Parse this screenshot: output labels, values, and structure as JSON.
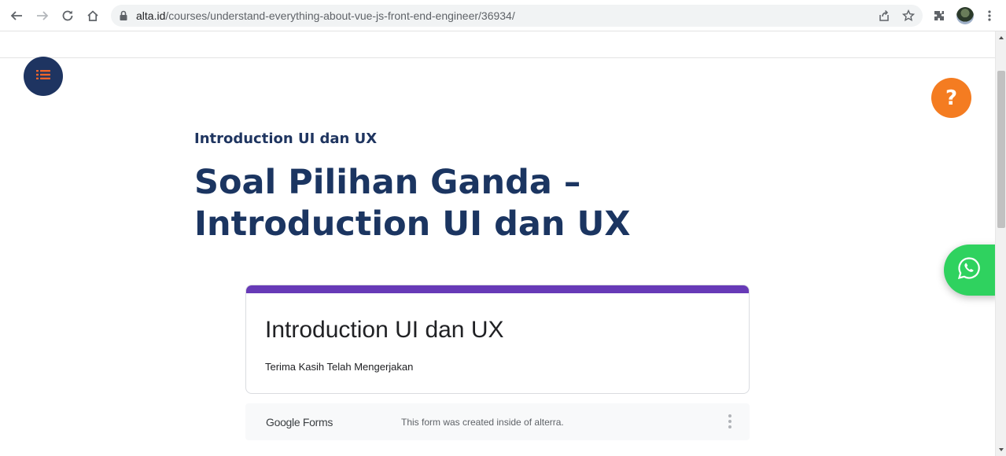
{
  "browser": {
    "url_host": "alta.id",
    "url_path": "/courses/understand-everything-about-vue-js-front-end-engineer/36934/"
  },
  "page": {
    "breadcrumb": "Introduction UI dan UX",
    "title": "Soal Pilihan Ganda – Introduction UI dan UX",
    "help_label": "?"
  },
  "form": {
    "title": "Introduction UI dan UX",
    "message": "Terima Kasih Telah Mengerjakan",
    "footer_logo": "Google Forms",
    "footer_note": "This form was created inside of alterra.",
    "accent_color": "#673ab7"
  },
  "colors": {
    "brand_navy": "#1b3561",
    "help_orange": "#f47c21",
    "whatsapp_green": "#2fd25f"
  },
  "icons": {
    "toolbar": [
      "back-icon",
      "forward-icon",
      "reload-icon",
      "home-icon",
      "lock-icon",
      "share-icon",
      "star-icon",
      "extensions-icon",
      "profile-avatar",
      "kebab-menu-icon"
    ],
    "page": [
      "list-menu-icon",
      "help-icon",
      "whatsapp-icon",
      "more-vert-icon"
    ]
  }
}
